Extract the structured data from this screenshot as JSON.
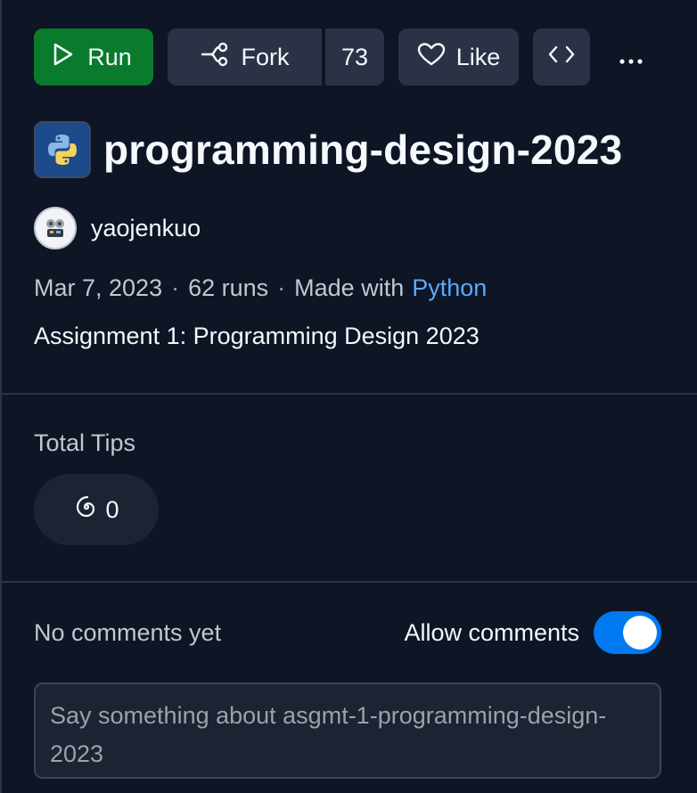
{
  "toolbar": {
    "run_label": "Run",
    "fork_label": "Fork",
    "fork_count": "73",
    "like_label": "Like"
  },
  "repl": {
    "title": "programming-design-2023",
    "author": "yaojenkuo",
    "date": "Mar 7, 2023",
    "runs": "62 runs",
    "made_with": "Made with",
    "language": "Python",
    "description": "Assignment 1: Programming Design 2023"
  },
  "tips": {
    "label": "Total Tips",
    "count": "0"
  },
  "comments": {
    "empty_text": "No comments yet",
    "allow_label": "Allow comments",
    "allow_enabled": true,
    "placeholder": "Say something about asgmt-1-programming-design-2023"
  },
  "icons": {
    "run": "play-icon",
    "fork": "fork-icon",
    "like": "heart-icon",
    "embed": "code-brackets-icon",
    "more": "ellipsis-icon",
    "tips": "spiral-icon"
  },
  "colors": {
    "background": "#0e1525",
    "run_button": "#0a7a2c",
    "secondary_button": "#2b3245",
    "link": "#57abff",
    "toggle_on": "#0079f2"
  }
}
